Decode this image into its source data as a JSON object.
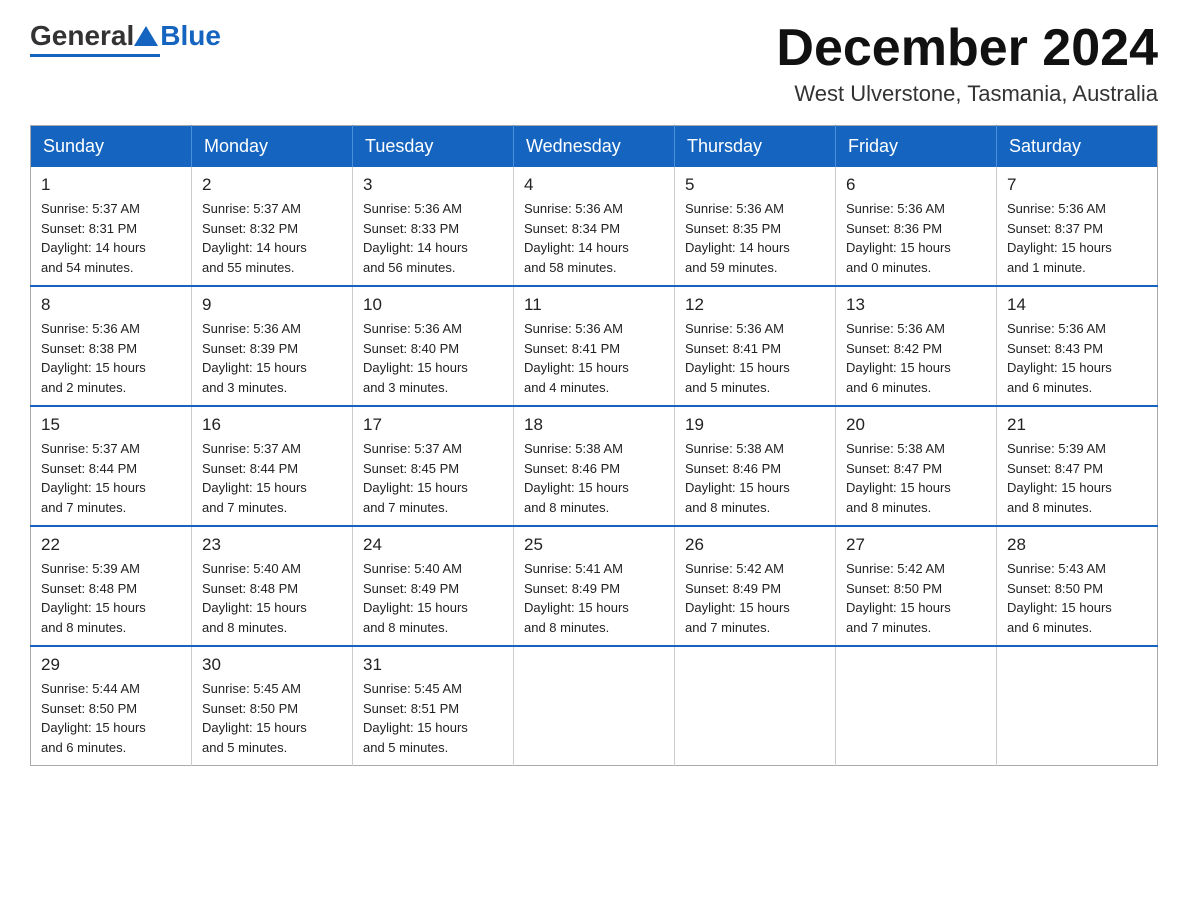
{
  "logo": {
    "general": "General",
    "blue": "Blue"
  },
  "title": "December 2024",
  "location": "West Ulverstone, Tasmania, Australia",
  "weekdays": [
    "Sunday",
    "Monday",
    "Tuesday",
    "Wednesday",
    "Thursday",
    "Friday",
    "Saturday"
  ],
  "weeks": [
    [
      {
        "day": "1",
        "sunrise": "5:37 AM",
        "sunset": "8:31 PM",
        "daylight": "14 hours and 54 minutes."
      },
      {
        "day": "2",
        "sunrise": "5:37 AM",
        "sunset": "8:32 PM",
        "daylight": "14 hours and 55 minutes."
      },
      {
        "day": "3",
        "sunrise": "5:36 AM",
        "sunset": "8:33 PM",
        "daylight": "14 hours and 56 minutes."
      },
      {
        "day": "4",
        "sunrise": "5:36 AM",
        "sunset": "8:34 PM",
        "daylight": "14 hours and 58 minutes."
      },
      {
        "day": "5",
        "sunrise": "5:36 AM",
        "sunset": "8:35 PM",
        "daylight": "14 hours and 59 minutes."
      },
      {
        "day": "6",
        "sunrise": "5:36 AM",
        "sunset": "8:36 PM",
        "daylight": "15 hours and 0 minutes."
      },
      {
        "day": "7",
        "sunrise": "5:36 AM",
        "sunset": "8:37 PM",
        "daylight": "15 hours and 1 minute."
      }
    ],
    [
      {
        "day": "8",
        "sunrise": "5:36 AM",
        "sunset": "8:38 PM",
        "daylight": "15 hours and 2 minutes."
      },
      {
        "day": "9",
        "sunrise": "5:36 AM",
        "sunset": "8:39 PM",
        "daylight": "15 hours and 3 minutes."
      },
      {
        "day": "10",
        "sunrise": "5:36 AM",
        "sunset": "8:40 PM",
        "daylight": "15 hours and 3 minutes."
      },
      {
        "day": "11",
        "sunrise": "5:36 AM",
        "sunset": "8:41 PM",
        "daylight": "15 hours and 4 minutes."
      },
      {
        "day": "12",
        "sunrise": "5:36 AM",
        "sunset": "8:41 PM",
        "daylight": "15 hours and 5 minutes."
      },
      {
        "day": "13",
        "sunrise": "5:36 AM",
        "sunset": "8:42 PM",
        "daylight": "15 hours and 6 minutes."
      },
      {
        "day": "14",
        "sunrise": "5:36 AM",
        "sunset": "8:43 PM",
        "daylight": "15 hours and 6 minutes."
      }
    ],
    [
      {
        "day": "15",
        "sunrise": "5:37 AM",
        "sunset": "8:44 PM",
        "daylight": "15 hours and 7 minutes."
      },
      {
        "day": "16",
        "sunrise": "5:37 AM",
        "sunset": "8:44 PM",
        "daylight": "15 hours and 7 minutes."
      },
      {
        "day": "17",
        "sunrise": "5:37 AM",
        "sunset": "8:45 PM",
        "daylight": "15 hours and 7 minutes."
      },
      {
        "day": "18",
        "sunrise": "5:38 AM",
        "sunset": "8:46 PM",
        "daylight": "15 hours and 8 minutes."
      },
      {
        "day": "19",
        "sunrise": "5:38 AM",
        "sunset": "8:46 PM",
        "daylight": "15 hours and 8 minutes."
      },
      {
        "day": "20",
        "sunrise": "5:38 AM",
        "sunset": "8:47 PM",
        "daylight": "15 hours and 8 minutes."
      },
      {
        "day": "21",
        "sunrise": "5:39 AM",
        "sunset": "8:47 PM",
        "daylight": "15 hours and 8 minutes."
      }
    ],
    [
      {
        "day": "22",
        "sunrise": "5:39 AM",
        "sunset": "8:48 PM",
        "daylight": "15 hours and 8 minutes."
      },
      {
        "day": "23",
        "sunrise": "5:40 AM",
        "sunset": "8:48 PM",
        "daylight": "15 hours and 8 minutes."
      },
      {
        "day": "24",
        "sunrise": "5:40 AM",
        "sunset": "8:49 PM",
        "daylight": "15 hours and 8 minutes."
      },
      {
        "day": "25",
        "sunrise": "5:41 AM",
        "sunset": "8:49 PM",
        "daylight": "15 hours and 8 minutes."
      },
      {
        "day": "26",
        "sunrise": "5:42 AM",
        "sunset": "8:49 PM",
        "daylight": "15 hours and 7 minutes."
      },
      {
        "day": "27",
        "sunrise": "5:42 AM",
        "sunset": "8:50 PM",
        "daylight": "15 hours and 7 minutes."
      },
      {
        "day": "28",
        "sunrise": "5:43 AM",
        "sunset": "8:50 PM",
        "daylight": "15 hours and 6 minutes."
      }
    ],
    [
      {
        "day": "29",
        "sunrise": "5:44 AM",
        "sunset": "8:50 PM",
        "daylight": "15 hours and 6 minutes."
      },
      {
        "day": "30",
        "sunrise": "5:45 AM",
        "sunset": "8:50 PM",
        "daylight": "15 hours and 5 minutes."
      },
      {
        "day": "31",
        "sunrise": "5:45 AM",
        "sunset": "8:51 PM",
        "daylight": "15 hours and 5 minutes."
      },
      null,
      null,
      null,
      null
    ]
  ]
}
